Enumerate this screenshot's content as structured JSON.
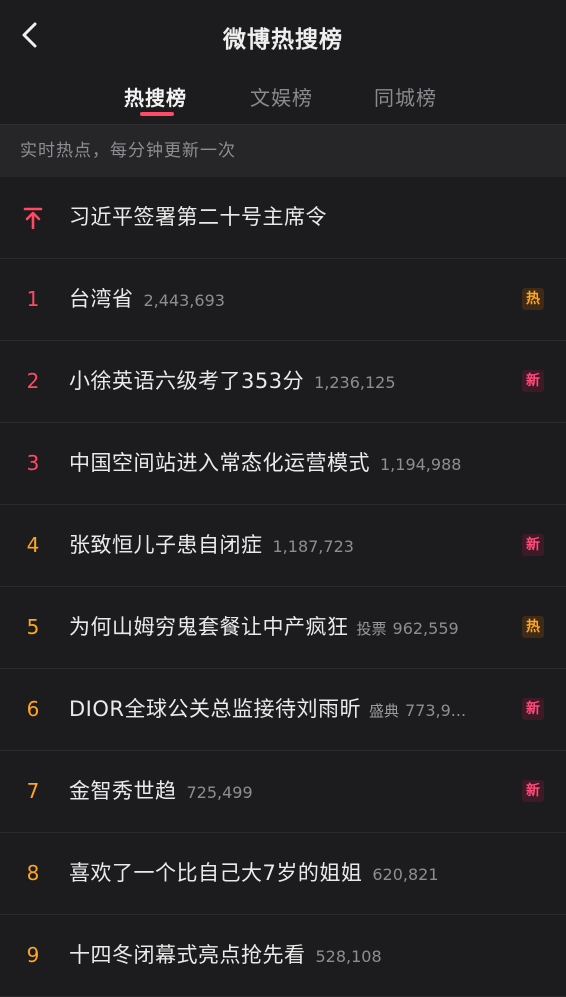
{
  "header": {
    "title": "微博热搜榜"
  },
  "tabs": [
    {
      "label": "热搜榜",
      "active": true
    },
    {
      "label": "文娱榜",
      "active": false
    },
    {
      "label": "同城榜",
      "active": false
    }
  ],
  "subheader": "实时热点，每分钟更新一次",
  "pinned": {
    "topic": "习近平签署第二十号主席令",
    "icon": "pin-top-icon"
  },
  "items": [
    {
      "rank": "1",
      "topic": "台湾省",
      "tag": "",
      "count": "2,443,693",
      "badge": "热"
    },
    {
      "rank": "2",
      "topic": "小徐英语六级考了353分",
      "tag": "",
      "count": "1,236,125",
      "badge": "新"
    },
    {
      "rank": "3",
      "topic": "中国空间站进入常态化运营模式",
      "tag": "",
      "count": "1,194,988",
      "badge": ""
    },
    {
      "rank": "4",
      "topic": "张致恒儿子患自闭症",
      "tag": "",
      "count": "1,187,723",
      "badge": "新"
    },
    {
      "rank": "5",
      "topic": "为何山姆穷鬼套餐让中产疯狂",
      "tag": "投票",
      "count": "962,559",
      "badge": "热"
    },
    {
      "rank": "6",
      "topic": "DIOR全球公关总监接待刘雨昕",
      "tag": "盛典",
      "count": "773,9...",
      "badge": "新"
    },
    {
      "rank": "7",
      "topic": "金智秀世趋",
      "tag": "",
      "count": "725,499",
      "badge": "新"
    },
    {
      "rank": "8",
      "topic": "喜欢了一个比自己大7岁的姐姐",
      "tag": "",
      "count": "620,821",
      "badge": ""
    },
    {
      "rank": "9",
      "topic": "十四冬闭幕式亮点抢先看",
      "tag": "",
      "count": "528,108",
      "badge": ""
    }
  ],
  "colors": {
    "background": "#1c1c1e",
    "accent": "#ff4a6a",
    "rank_top": "#ff4a62",
    "rank_other": "#ffa51f",
    "badge_hot": "#ffa51f",
    "badge_new": "#ff4a7a"
  }
}
